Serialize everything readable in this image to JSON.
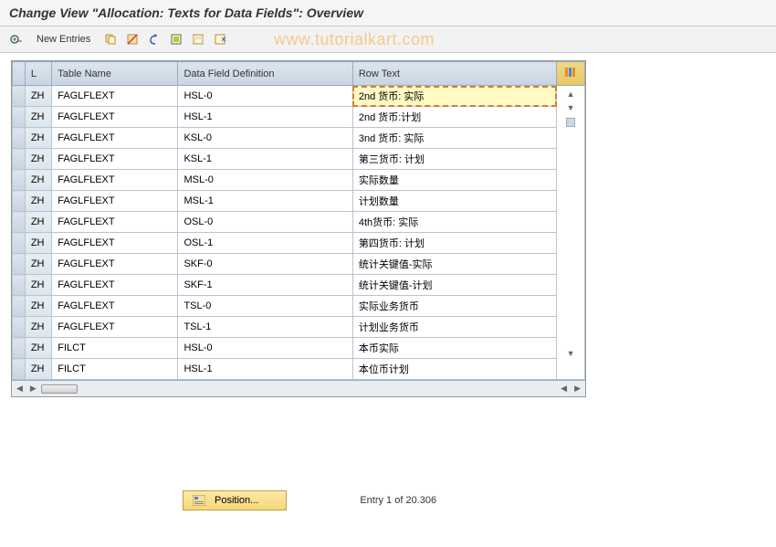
{
  "header": {
    "title": "Change View \"Allocation: Texts for Data Fields\": Overview"
  },
  "toolbar": {
    "new_entries_label": "New Entries"
  },
  "watermark": "www.tutorialkart.com",
  "table": {
    "columns": {
      "l": "L",
      "table_name": "Table Name",
      "data_field": "Data Field Definition",
      "row_text": "Row Text"
    },
    "rows": [
      {
        "l": "ZH",
        "table": "FAGLFLEXT",
        "field": "HSL-0",
        "text": "2nd 货币: 实际",
        "selected": true
      },
      {
        "l": "ZH",
        "table": "FAGLFLEXT",
        "field": "HSL-1",
        "text": "2nd 货币:计划"
      },
      {
        "l": "ZH",
        "table": "FAGLFLEXT",
        "field": "KSL-0",
        "text": "3nd 货币: 实际"
      },
      {
        "l": "ZH",
        "table": "FAGLFLEXT",
        "field": "KSL-1",
        "text": "第三货币: 计划"
      },
      {
        "l": "ZH",
        "table": "FAGLFLEXT",
        "field": "MSL-0",
        "text": "实际数量"
      },
      {
        "l": "ZH",
        "table": "FAGLFLEXT",
        "field": "MSL-1",
        "text": "计划数量"
      },
      {
        "l": "ZH",
        "table": "FAGLFLEXT",
        "field": "OSL-0",
        "text": "4th货币: 实际"
      },
      {
        "l": "ZH",
        "table": "FAGLFLEXT",
        "field": "OSL-1",
        "text": "第四货币: 计划"
      },
      {
        "l": "ZH",
        "table": "FAGLFLEXT",
        "field": "SKF-0",
        "text": "统计关键值-实际"
      },
      {
        "l": "ZH",
        "table": "FAGLFLEXT",
        "field": "SKF-1",
        "text": "统计关键值-计划"
      },
      {
        "l": "ZH",
        "table": "FAGLFLEXT",
        "field": "TSL-0",
        "text": "实际业务货币"
      },
      {
        "l": "ZH",
        "table": "FAGLFLEXT",
        "field": "TSL-1",
        "text": "计划业务货币"
      },
      {
        "l": "ZH",
        "table": "FILCT",
        "field": "HSL-0",
        "text": "本币实际"
      },
      {
        "l": "ZH",
        "table": "FILCT",
        "field": "HSL-1",
        "text": "本位币计划"
      }
    ]
  },
  "footer": {
    "position_label": "Position...",
    "entry_info": "Entry 1 of 20.306"
  }
}
